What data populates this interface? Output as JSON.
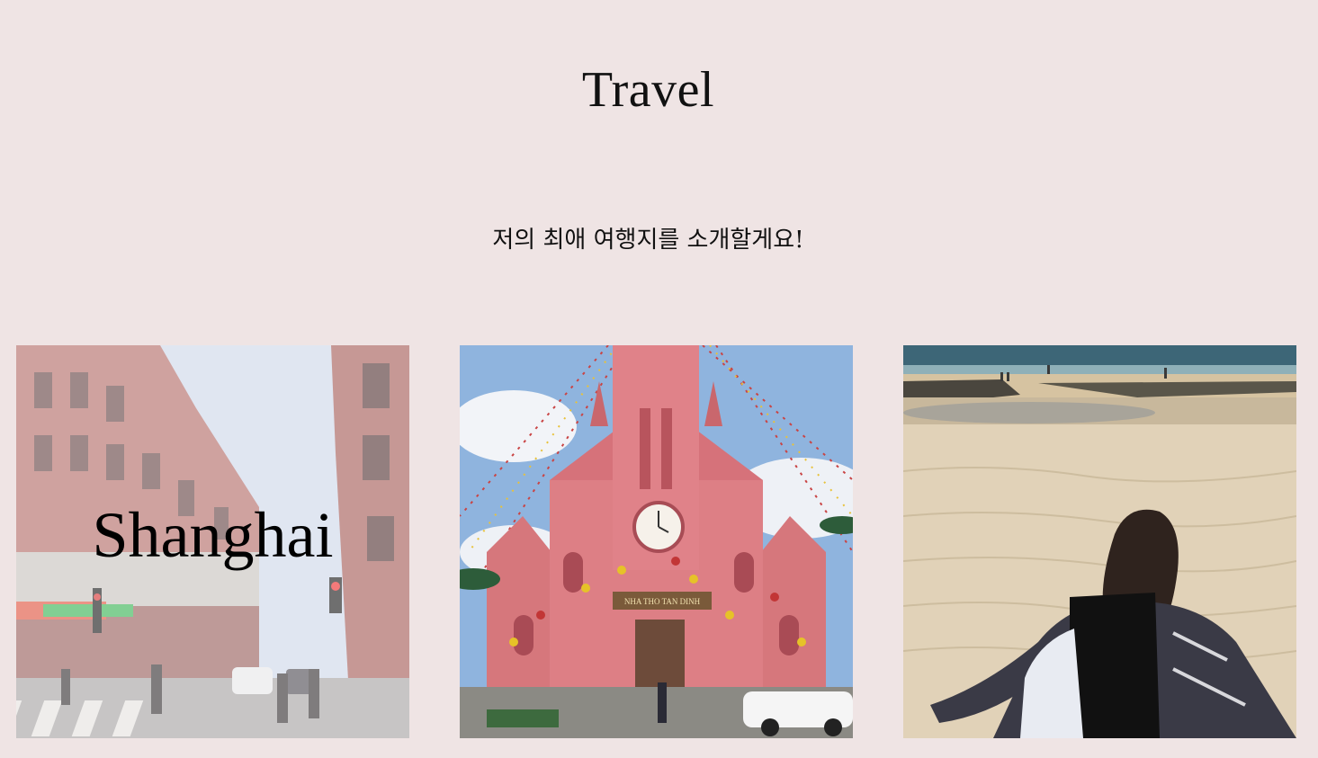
{
  "header": {
    "title": "Travel",
    "subtitle": "저의 최애 여행지를 소개할게요!"
  },
  "gallery": {
    "cards": [
      {
        "label": "Shanghai",
        "image": "shanghai-street-photo",
        "hovered": true
      },
      {
        "label": "",
        "image": "pink-church-photo",
        "sign_text": "NHA THO TAN DINH",
        "hovered": false
      },
      {
        "label": "",
        "image": "beach-photo",
        "hovered": false
      }
    ]
  },
  "colors": {
    "background": "#efe4e4",
    "text": "#111111"
  }
}
